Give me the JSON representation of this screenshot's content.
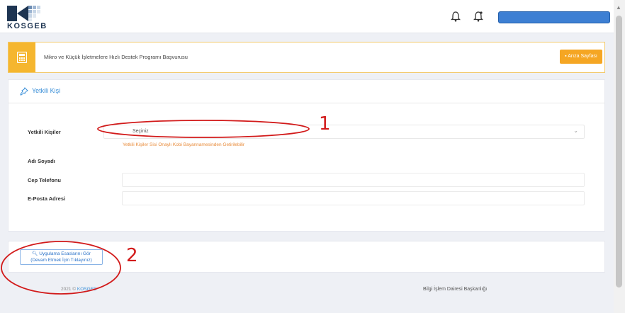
{
  "header": {
    "logo_text": "KOSGEB",
    "user_name_redacted": true
  },
  "application": {
    "title": "Mikro ve Küçük İşletmelere Hızlı Destek Programı Başvurusu",
    "list_button": "Arıza Sayfası"
  },
  "section": {
    "title": "Yetkili Kişi",
    "fields": {
      "yetkili_kisiler_label": "Yetkili Kişiler",
      "select_value": "Seçiniz",
      "warning": "Yetkili Kişiler Sisi Onaylı Kobi Bayannamesinden Getirilebilir",
      "ad_soyad_label": "Adı Soyadı",
      "cep_telefonu_label": "Cep Telefonu",
      "eposta_label": "E-Posta Adresi",
      "cep_telefonu_value": "",
      "eposta_value": ""
    }
  },
  "guide_button": {
    "line1": "Uygulama Esaslarını Gör",
    "line2": "(Devam Etmek İçin Tıklayınız)"
  },
  "footer": {
    "left_prefix": "2021 ©",
    "left_brand": "KOSGEB",
    "right": "Bilgi İşlem Dairesi Başkanlığı"
  },
  "annotations": {
    "one": "1",
    "two": "2",
    "color": "#d21a1a"
  },
  "colors": {
    "accent_orange": "#f5a623",
    "brand_blue": "#3a8fd8",
    "warning": "#e88b3a"
  }
}
